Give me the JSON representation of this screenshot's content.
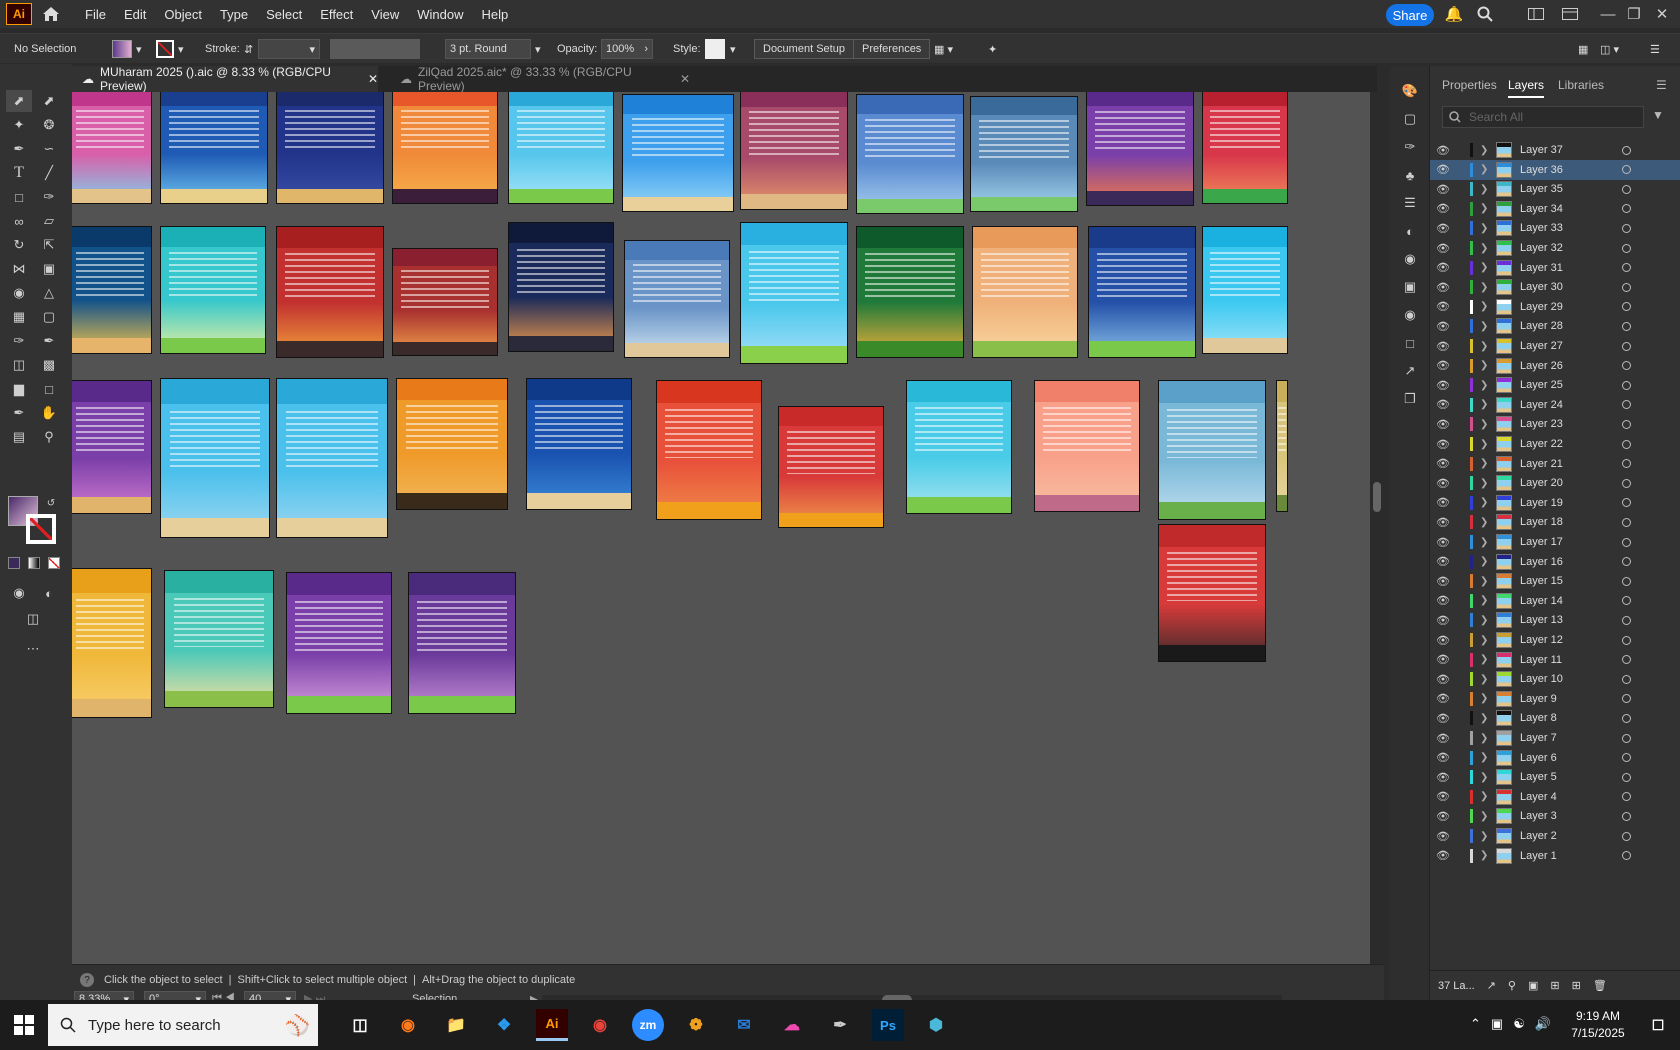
{
  "menubar": {
    "app_logo": "Ai",
    "items": [
      "File",
      "Edit",
      "Object",
      "Type",
      "Select",
      "Effect",
      "View",
      "Window",
      "Help"
    ],
    "share_label": "Share"
  },
  "control_bar": {
    "selection": "No Selection",
    "stroke_label": "Stroke:",
    "brush": "3 pt. Round",
    "opacity_label": "Opacity:",
    "opacity_value": "100%",
    "style_label": "Style:",
    "doc_setup": "Document Setup",
    "preferences": "Preferences"
  },
  "tabs": [
    {
      "label": "MUharam 2025 ().aic @ 8.33 % (RGB/CPU Preview)",
      "active": true
    },
    {
      "label": "ZilQad 2025.aic* @ 33.33 % (RGB/CPU Preview)",
      "active": false
    }
  ],
  "status": {
    "hint_click": "Click the object to select",
    "hint_shift": "Shift+Click to select multiple object",
    "hint_alt": "Alt+Drag the object to duplicate",
    "zoom": "8.33%",
    "rotation": "0°",
    "artboard": "40",
    "tool_name": "Selection"
  },
  "panel": {
    "tabs": [
      "Properties",
      "Layers",
      "Libraries"
    ],
    "search_placeholder": "Search All",
    "footer_count": "37 La...",
    "layers": [
      {
        "name": "Layer 37",
        "color": "#111111"
      },
      {
        "name": "Layer 36",
        "color": "#2f8cd8"
      },
      {
        "name": "Layer 35",
        "color": "#3fb6c8"
      },
      {
        "name": "Layer 34",
        "color": "#2f9e3c"
      },
      {
        "name": "Layer 33",
        "color": "#2f6fd8"
      },
      {
        "name": "Layer 32",
        "color": "#2fbf4c"
      },
      {
        "name": "Layer 31",
        "color": "#6a2fd8"
      },
      {
        "name": "Layer 30",
        "color": "#2faf3c"
      },
      {
        "name": "Layer 29",
        "color": "#ffffff"
      },
      {
        "name": "Layer 28",
        "color": "#2f6fd8"
      },
      {
        "name": "Layer 27",
        "color": "#d8c02f"
      },
      {
        "name": "Layer 26",
        "color": "#d89c2f"
      },
      {
        "name": "Layer 25",
        "color": "#8f2fd8"
      },
      {
        "name": "Layer 24",
        "color": "#3fd8c8"
      },
      {
        "name": "Layer 23",
        "color": "#d84f8f"
      },
      {
        "name": "Layer 22",
        "color": "#d8d82f"
      },
      {
        "name": "Layer 21",
        "color": "#d8602f"
      },
      {
        "name": "Layer 20",
        "color": "#2fd89c"
      },
      {
        "name": "Layer 19",
        "color": "#2f3fd8"
      },
      {
        "name": "Layer 18",
        "color": "#d82f3f"
      },
      {
        "name": "Layer 17",
        "color": "#2f8fd8"
      },
      {
        "name": "Layer 16",
        "color": "#222288"
      },
      {
        "name": "Layer 15",
        "color": "#d87a2f"
      },
      {
        "name": "Layer 14",
        "color": "#3fd86f"
      },
      {
        "name": "Layer 13",
        "color": "#2f7fd8"
      },
      {
        "name": "Layer 12",
        "color": "#c8a02f"
      },
      {
        "name": "Layer 11",
        "color": "#d82f6f"
      },
      {
        "name": "Layer 10",
        "color": "#9cd82f"
      },
      {
        "name": "Layer 9",
        "color": "#d8802f"
      },
      {
        "name": "Layer 8",
        "color": "#111111"
      },
      {
        "name": "Layer 7",
        "color": "#a0a0a0"
      },
      {
        "name": "Layer 6",
        "color": "#2fa0d8"
      },
      {
        "name": "Layer 5",
        "color": "#2fd8d8"
      },
      {
        "name": "Layer 4",
        "color": "#d82f2f"
      },
      {
        "name": "Layer 3",
        "color": "#4fd84f"
      },
      {
        "name": "Layer 2",
        "color": "#3f6fd8"
      },
      {
        "name": "Layer 1",
        "color": "#d8d8d8"
      }
    ]
  },
  "artboards": [
    {
      "id": "ab-1",
      "header": "#c0368a",
      "body": "#d85fa8",
      "sky": "#7fd1ec",
      "ground": "#e3c38a"
    },
    {
      "id": "ab-2",
      "header": "#1a3f8f",
      "body": "#1f5bb5",
      "sky": "#6ec3f0",
      "ground": "#e8cf8a"
    },
    {
      "id": "ab-3",
      "header": "#1a2a6b",
      "body": "#22348a",
      "sky": "#3a4fa8",
      "ground": "#e0b66a"
    },
    {
      "id": "ab-4",
      "header": "#e8572a",
      "body": "#f08a3a",
      "sky": "#f6b04a",
      "ground": "#3a1e3a"
    },
    {
      "id": "ab-5",
      "header": "#2aa8d8",
      "body": "#56c6ec",
      "sky": "#a8e6f8",
      "ground": "#7ac94a"
    },
    {
      "id": "ab-6",
      "header": "#1f82d8",
      "body": "#3ea0ec",
      "sky": "#9ad8f8",
      "ground": "#e9cf9a"
    },
    {
      "id": "ab-7",
      "header": "#8a2f5a",
      "body": "#a84a6a",
      "sky": "#e89a6a",
      "ground": "#e0b884"
    },
    {
      "id": "ab-8",
      "header": "#3a6ab5",
      "body": "#5a8ad0",
      "sky": "#a8d0f0",
      "ground": "#7ac96a"
    },
    {
      "id": "ab-9",
      "header": "#3a6a9a",
      "body": "#5a8ab8",
      "sky": "#a8d8f0",
      "ground": "#7ac96a"
    },
    {
      "id": "ab-10",
      "header": "#5a2a8a",
      "body": "#7a3fa8",
      "sky": "#f07a4a",
      "ground": "#3a2a5a"
    },
    {
      "id": "ab-11",
      "header": "#b81f2f",
      "body": "#d8364a",
      "sky": "#f08a5a",
      "ground": "#3aa84a"
    },
    {
      "id": "ab-12",
      "header": "#0a3a6a",
      "body": "#12528a",
      "sky": "#f0c24a",
      "ground": "#e6b46a"
    },
    {
      "id": "ab-13",
      "header": "#1ab0b5",
      "body": "#36c8cc",
      "sky": "#e8f0a0",
      "ground": "#7ac94a"
    },
    {
      "id": "ab-14",
      "header": "#a81f1f",
      "body": "#c23030",
      "sky": "#f0a03a",
      "ground": "#3a2a2a"
    },
    {
      "id": "ab-15",
      "header": "#8a1f2f",
      "body": "#a8302f",
      "sky": "#f0a04a",
      "ground": "#3a2a2a"
    },
    {
      "id": "ab-16",
      "header": "#0f1a3a",
      "body": "#1a2a5a",
      "sky": "#f09a4a",
      "ground": "#2a2a3a"
    },
    {
      "id": "ab-17",
      "header": "#4a7ab8",
      "body": "#6a94c8",
      "sky": "#d0e4f0",
      "ground": "#e0c89a"
    },
    {
      "id": "ab-18",
      "header": "#2ab0e0",
      "body": "#4ac8ec",
      "sky": "#a8e0f8",
      "ground": "#8ad04a"
    },
    {
      "id": "ab-19",
      "header": "#0f5a2a",
      "body": "#1f7a3a",
      "sky": "#f0b03a",
      "ground": "#3a8a2a"
    },
    {
      "id": "ab-20",
      "header": "#e89a5a",
      "body": "#f0b07a",
      "sky": "#f8d8a0",
      "ground": "#8ac04a"
    },
    {
      "id": "ab-21",
      "header": "#1a3a8a",
      "body": "#2450a8",
      "sky": "#8ac0e8",
      "ground": "#7ac94a"
    },
    {
      "id": "ab-22",
      "header": "#1ab0e0",
      "body": "#3ac8f0",
      "sky": "#a0e4f8",
      "ground": "#e0c89a"
    },
    {
      "id": "ab-23",
      "header": "#5a2a8a",
      "body": "#7a3fa8",
      "sky": "#d07ad0",
      "ground": "#e0b46a"
    },
    {
      "id": "ab-24",
      "header": "#2aa8d8",
      "body": "#4ac0ec",
      "sky": "#a0d8f0",
      "ground": "#e6cf9a"
    },
    {
      "id": "ab-25",
      "header": "#2aa8d8",
      "body": "#4ac0ec",
      "sky": "#a0d8f0",
      "ground": "#e6cf9a"
    },
    {
      "id": "ab-26",
      "header": "#e87a1a",
      "body": "#f09a2a",
      "sky": "#f0b85a",
      "ground": "#3a2a1a"
    },
    {
      "id": "ab-27",
      "header": "#0f3a8a",
      "body": "#1a52b0",
      "sky": "#3a8ad8",
      "ground": "#e6cf9a"
    },
    {
      "id": "ab-28",
      "header": "#d8361f",
      "body": "#e8503a",
      "sky": "#f08a4a",
      "ground": "#f0a01a"
    },
    {
      "id": "ab-29",
      "header": "#c82a2a",
      "body": "#d83a3a",
      "sky": "#f09a4a",
      "ground": "#f0a01a"
    },
    {
      "id": "ab-30",
      "header": "#2ab8d8",
      "body": "#4acce8",
      "sky": "#a8e4f0",
      "ground": "#7ac94a"
    },
    {
      "id": "ab-31",
      "header": "#f0806a",
      "body": "#f8a08a",
      "sky": "#f8c0a0",
      "ground": "#c06a8a"
    },
    {
      "id": "ab-32",
      "header": "#5aa0c8",
      "body": "#7ab8d8",
      "sky": "#c0e0f0",
      "ground": "#6ab04a"
    },
    {
      "id": "ab-33",
      "header": "#c8b05a",
      "body": "#d8c47a",
      "sky": "#e8d8a0",
      "ground": "#6a8a3a"
    },
    {
      "id": "ab-34",
      "header": "#e8a01a",
      "body": "#f0b83a",
      "sky": "#f8d070",
      "ground": "#e0b46a"
    },
    {
      "id": "ab-35",
      "header": "#2ab0a0",
      "body": "#4ac8b8",
      "sky": "#f0e0a0",
      "ground": "#8ac04a"
    },
    {
      "id": "ab-36",
      "header": "#5a2a8a",
      "body": "#7a3fa8",
      "sky": "#d8a0e0",
      "ground": "#7ac94a"
    },
    {
      "id": "ab-37",
      "header": "#4a2a7a",
      "body": "#6a3a9a",
      "sky": "#c890d8",
      "ground": "#7ac94a"
    },
    {
      "id": "ab-38",
      "header": "#c02a2a",
      "body": "#d83a3a",
      "sky": "#3a2a2a",
      "ground": "#1a1a1a"
    }
  ],
  "taskbar": {
    "search_placeholder": "Type here to search",
    "time": "9:19 AM",
    "date": "7/15/2025",
    "apps": [
      "Ai",
      "zm",
      "Ps"
    ]
  }
}
